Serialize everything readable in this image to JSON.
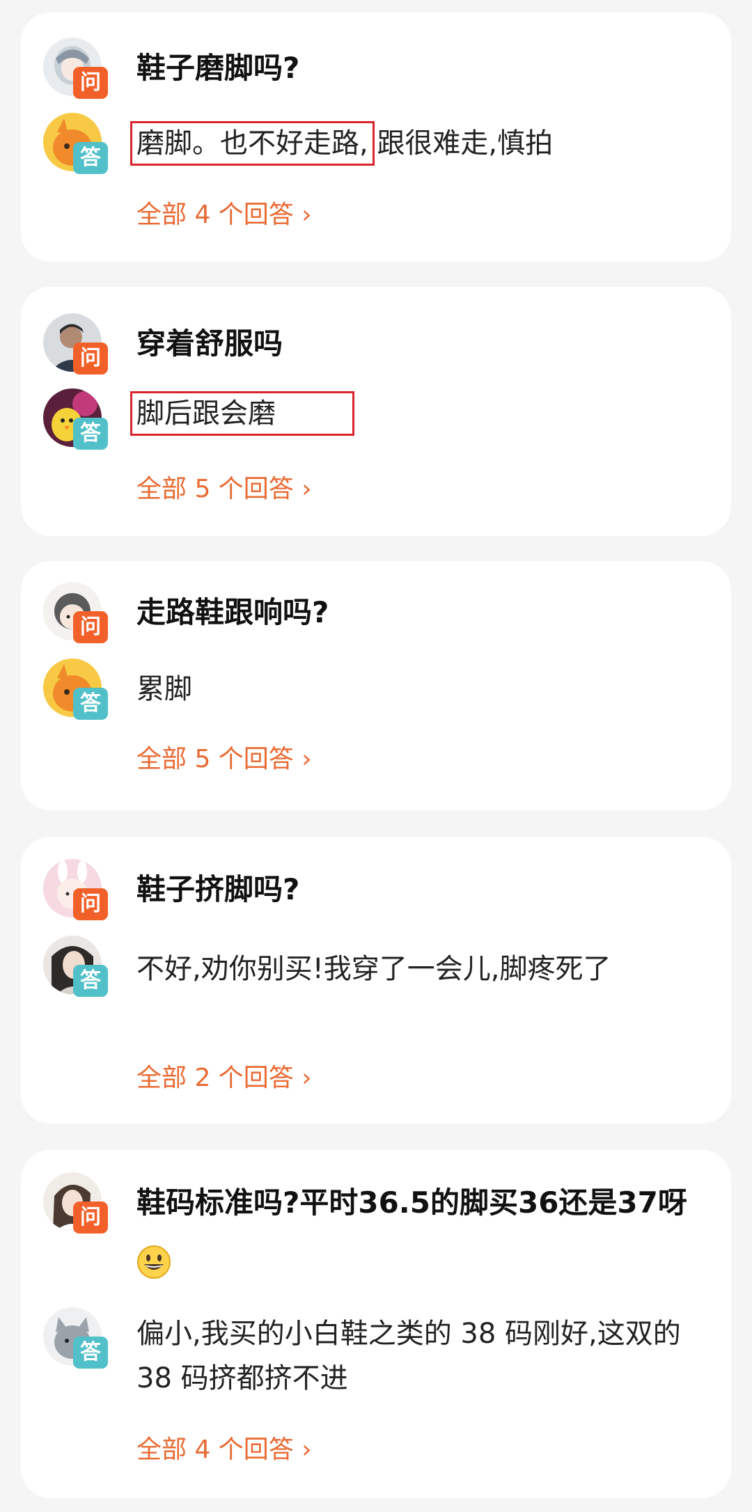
{
  "labels": {
    "ask": "问",
    "answer": "答"
  },
  "colors": {
    "accent_link": "#e96a32",
    "ask_badge": "#f2602a",
    "answer_badge": "#52c0c9",
    "highlight_box": "#d9242a"
  },
  "cards": [
    {
      "question": "鞋子磨脚吗?",
      "answer_highlight": "磨脚。也不好走路,",
      "answer_rest": "跟很难走,慎拍",
      "all_answers": "全部 4 个回答 ›"
    },
    {
      "question": "穿着舒服吗",
      "answer_highlight": "脚后跟会磨",
      "answer_rest": "",
      "all_answers": "全部 5 个回答 ›"
    },
    {
      "question": "走路鞋跟响吗?",
      "answer": "累脚",
      "all_answers": "全部 5 个回答 ›"
    },
    {
      "question": "鞋子挤脚吗?",
      "answer": "不好,劝你别买!我穿了一会儿,脚疼死了",
      "all_answers": "全部 2 个回答 ›"
    },
    {
      "question": "鞋码标准吗?平时36.5的脚买36还是37呀",
      "question_emoji": "grinning-face-emoji",
      "answer": "偏小,我买的小白鞋之类的 38 码刚好,这双的 38 码挤都挤不进",
      "all_answers": "全部 4 个回答 ›"
    }
  ]
}
